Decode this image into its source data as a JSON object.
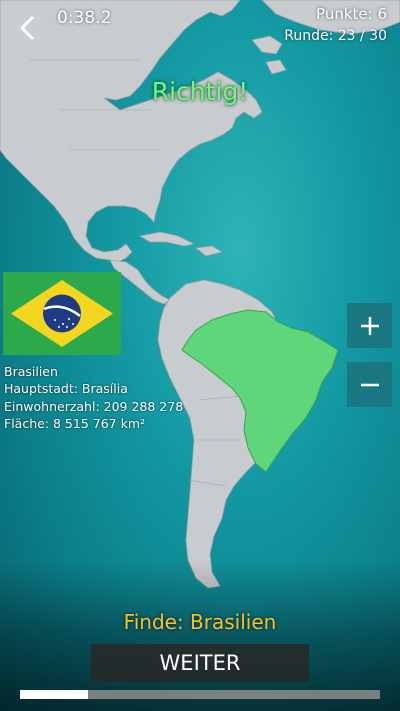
{
  "game": {
    "timer": "0:38.2",
    "score": "Punkte: 6",
    "round": "Runde: 23 / 30",
    "round_progress": 0.1875,
    "feedback": "Richtig!",
    "find_prompt": "Finde: Brasilien",
    "next_label": "WEITER"
  },
  "country": {
    "name": "Brasilien",
    "capital": "Hauptstadt: Brasília",
    "population": "Einwohnerzahl: 209 288 278",
    "area": "Fläche: 8 515 767 km²"
  },
  "controls": {
    "back_icon": "chevron-left-icon",
    "zoom_in_icon": "plus-icon",
    "zoom_out_icon": "minus-icon"
  },
  "colors": {
    "land": "#c9ccce",
    "highlight": "#5fd67a",
    "feedback": "#7cf08a",
    "prompt": "#f6c32c",
    "flag_green": "#2ca94a",
    "flag_yellow": "#f5d61f",
    "flag_blue": "#1f3a86"
  }
}
